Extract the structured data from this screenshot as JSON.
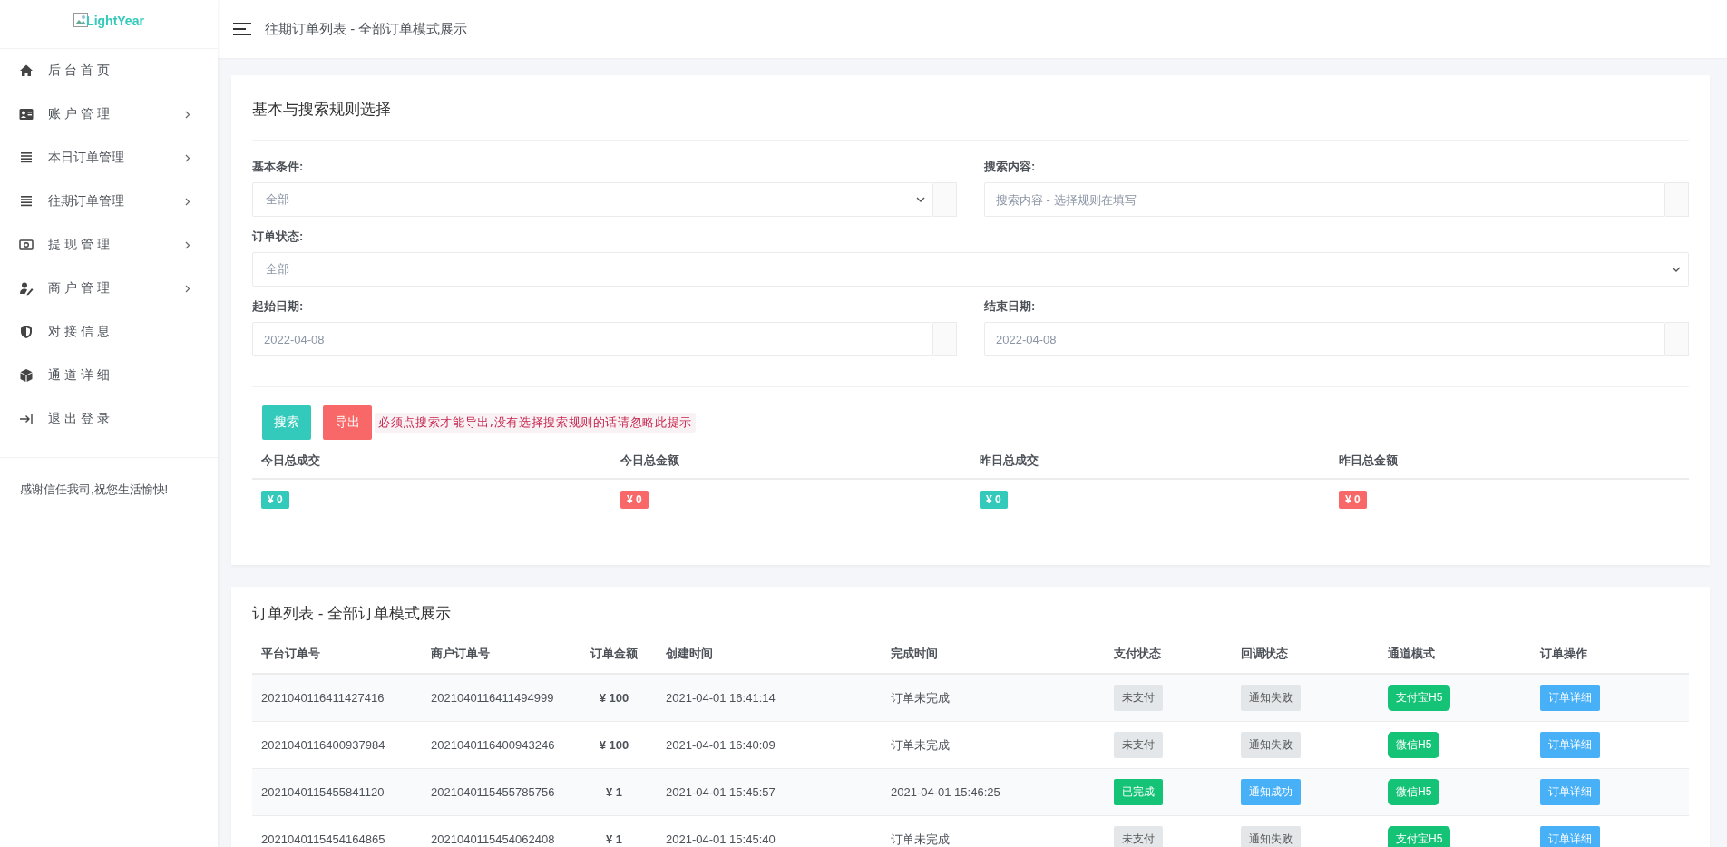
{
  "logo": {
    "text": "LightYear"
  },
  "sidebar": {
    "items": [
      {
        "label": "后 台 首 页",
        "expandable": false
      },
      {
        "label": "账 户 管 理",
        "expandable": true
      },
      {
        "label": "本日订单管理",
        "expandable": true
      },
      {
        "label": "往期订单管理",
        "expandable": true
      },
      {
        "label": "提 现 管 理",
        "expandable": true
      },
      {
        "label": "商 户 管 理",
        "expandable": true
      },
      {
        "label": "对 接 信 息",
        "expandable": false
      },
      {
        "label": "通 道 详 细",
        "expandable": false
      },
      {
        "label": "退 出 登 录",
        "expandable": false
      }
    ],
    "footer": "感谢信任我司,祝您生活愉快!"
  },
  "header": {
    "title": "往期订单列表 - 全部订单模式展示"
  },
  "search_card": {
    "title": "基本与搜索规则选择",
    "rows": [
      [
        {
          "label": "基本条件:",
          "kind": "select",
          "value": "全部"
        },
        {
          "label": "搜索内容:",
          "kind": "input",
          "placeholder": "搜索内容 - 选择规则在填写"
        }
      ],
      [
        {
          "label": "订单状态:",
          "kind": "select-full",
          "value": "全部"
        }
      ],
      [
        {
          "label": "起始日期:",
          "kind": "input",
          "value": "2022-04-08"
        },
        {
          "label": "结束日期:",
          "kind": "input",
          "value": "2022-04-08"
        }
      ]
    ],
    "buttons": [
      {
        "label": "搜索",
        "kind": "primary"
      },
      {
        "label": "导出",
        "kind": "danger"
      }
    ],
    "hint": "必须点搜索才能导出,没有选择搜索规则的话请忽略此提示",
    "stats": [
      {
        "label": "今日总成交",
        "value": "¥ 0",
        "kind": "teal"
      },
      {
        "label": "今日总金额",
        "value": "¥ 0",
        "kind": "red"
      },
      {
        "label": "昨日总成交",
        "value": "¥ 0",
        "kind": "teal"
      },
      {
        "label": "昨日总金额",
        "value": "¥ 0",
        "kind": "red"
      }
    ]
  },
  "orders_card": {
    "title": "订单列表 - 全部订单模式展示",
    "columns": [
      "平台订单号",
      "商户订单号",
      "订单金额",
      "创建时间",
      "完成时间",
      "支付状态",
      "回调状态",
      "通道模式",
      "订单操作"
    ],
    "rows": [
      {
        "platform_no": "2021040116411427416",
        "merchant_no": "2021040116411494999",
        "amount": "¥ 100",
        "created": "2021-04-01 16:41:14",
        "completed": "订单未完成",
        "pay_status": {
          "text": "未支付",
          "kind": "muted"
        },
        "callback": {
          "text": "通知失败",
          "kind": "muted"
        },
        "channel": "支付宝H5",
        "action": "订单详细"
      },
      {
        "platform_no": "2021040116400937984",
        "merchant_no": "2021040116400943246",
        "amount": "¥ 100",
        "created": "2021-04-01 16:40:09",
        "completed": "订单未完成",
        "pay_status": {
          "text": "未支付",
          "kind": "muted"
        },
        "callback": {
          "text": "通知失败",
          "kind": "muted"
        },
        "channel": "微信H5",
        "action": "订单详细"
      },
      {
        "platform_no": "2021040115455841120",
        "merchant_no": "2021040115455785756",
        "amount": "¥ 1",
        "created": "2021-04-01 15:45:57",
        "completed": "2021-04-01 15:46:25",
        "pay_status": {
          "text": "已完成",
          "kind": "success"
        },
        "callback": {
          "text": "通知成功",
          "kind": "info"
        },
        "channel": "微信H5",
        "action": "订单详细"
      },
      {
        "platform_no": "2021040115454164865",
        "merchant_no": "2021040115454062408",
        "amount": "¥ 1",
        "created": "2021-04-01 15:45:40",
        "completed": "订单未完成",
        "pay_status": {
          "text": "未支付",
          "kind": "muted"
        },
        "callback": {
          "text": "通知失败",
          "kind": "muted"
        },
        "channel": "支付宝H5",
        "action": "订单详细"
      }
    ]
  }
}
